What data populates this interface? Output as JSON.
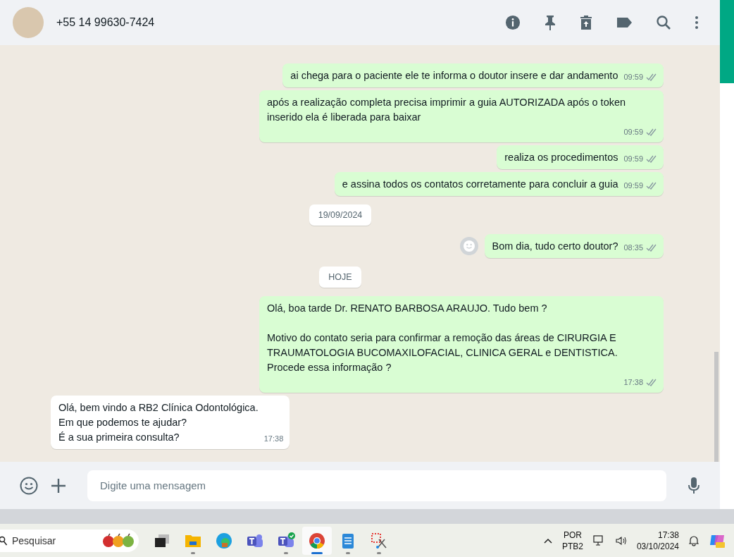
{
  "header": {
    "contact": "+55 14 99630-7424"
  },
  "messages": [
    {
      "kind": "outgoing",
      "text": "ai chega para o paciente ele te informa o doutor insere e dar andamento",
      "time": "09:59",
      "read": true,
      "reaction_button": false
    },
    {
      "kind": "outgoing",
      "text": "após a realização completa precisa imprimir a guia AUTORIZADA após o token inserido ela é liberada para baixar",
      "time": "09:59",
      "read": true,
      "reaction_button": false
    },
    {
      "kind": "outgoing",
      "text": "realiza os procedimentos",
      "time": "09:59",
      "read": true,
      "reaction_button": false
    },
    {
      "kind": "outgoing",
      "text": "e assina todos os contatos corretamente para concluir a guia",
      "time": "09:59",
      "read": true,
      "reaction_button": false
    },
    {
      "kind": "date",
      "text": "19/09/2024"
    },
    {
      "kind": "outgoing",
      "text": "Bom dia, tudo certo doutor?",
      "time": "08:35",
      "read": true,
      "reaction_button": true
    },
    {
      "kind": "date",
      "text": "HOJE"
    },
    {
      "kind": "outgoing",
      "text": "Olá, boa tarde Dr. RENATO BARBOSA ARAUJO. Tudo bem ?\n\nMotivo do contato seria para confirmar a remoção das áreas de CIRURGIA E TRAUMATOLOGIA BUCOMAXILOFACIAL, CLINICA GERAL e DENTISTICA.\nProcede essa informação ?",
      "time": "17:38",
      "read": true,
      "reaction_button": false
    },
    {
      "kind": "incoming",
      "text": "Olá, bem vindo a RB2 Clínica Odontológica.\nEm que podemos te ajudar?\nÉ a sua primeira consulta?",
      "time": "17:38"
    }
  ],
  "composer": {
    "placeholder": "Digite uma mensagem"
  },
  "taskbar": {
    "search_placeholder": "Pesquisar",
    "apps": [
      {
        "kind": "taskview",
        "selected": false,
        "running": false
      },
      {
        "kind": "explorer",
        "selected": false,
        "running": true
      },
      {
        "kind": "edge",
        "selected": false,
        "running": false
      },
      {
        "kind": "teams",
        "selected": false,
        "running": false
      },
      {
        "kind": "teams-work",
        "selected": false,
        "running": true
      },
      {
        "kind": "chrome",
        "selected": true,
        "running": true
      },
      {
        "kind": "notepad",
        "selected": false,
        "running": true
      },
      {
        "kind": "snip",
        "selected": false,
        "running": true
      }
    ],
    "language": "POR",
    "layout": "PTB2",
    "time": "17:38",
    "date": "03/10/2024"
  }
}
